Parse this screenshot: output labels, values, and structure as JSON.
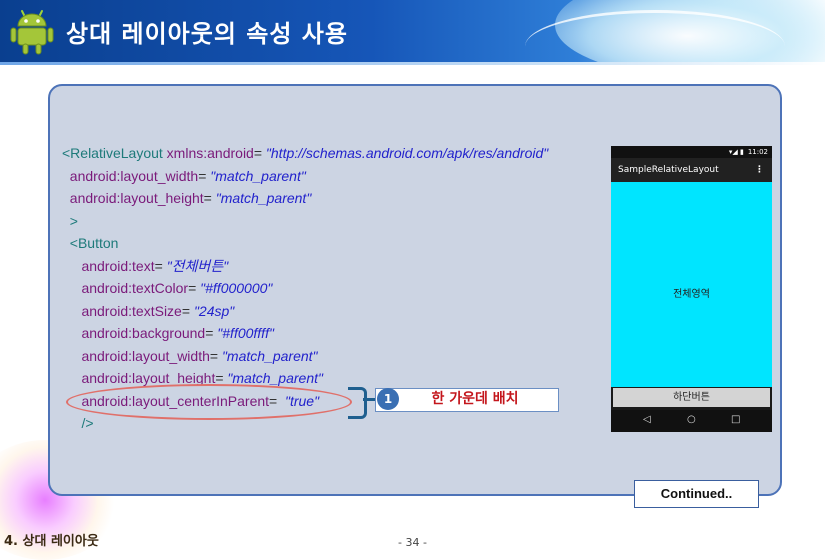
{
  "header": {
    "title": "상대 레이아웃의 속성 사용"
  },
  "code": {
    "lines": [
      {
        "indent": "",
        "tag": "<RelativeLayout",
        "attr": " xmlns:android",
        "eq": "= ",
        "val": "\"http://schemas.android.com/apk/res/android\""
      },
      {
        "indent": "  ",
        "tag": "",
        "attr": "android:layout_width",
        "eq": "= ",
        "val": "\"match_parent\""
      },
      {
        "indent": "  ",
        "tag": "",
        "attr": "android:layout_height",
        "eq": "= ",
        "val": "\"match_parent\""
      },
      {
        "indent": "  ",
        "tag": ">",
        "attr": "",
        "eq": "",
        "val": ""
      },
      {
        "indent": "  ",
        "tag": "<Button",
        "attr": "",
        "eq": "",
        "val": ""
      },
      {
        "indent": "     ",
        "tag": "",
        "attr": "android:text",
        "eq": "= ",
        "val": "\"전체버튼\""
      },
      {
        "indent": "     ",
        "tag": "",
        "attr": "android:textColor",
        "eq": "= ",
        "val": "\"#ff000000\""
      },
      {
        "indent": "     ",
        "tag": "",
        "attr": "android:textSize",
        "eq": "= ",
        "val": "\"24sp\""
      },
      {
        "indent": "     ",
        "tag": "",
        "attr": "android:background",
        "eq": "= ",
        "val": "\"#ff00ffff\""
      },
      {
        "indent": "     ",
        "tag": "",
        "attr": "android:layout_width",
        "eq": "= ",
        "val": "\"match_parent\""
      },
      {
        "indent": "     ",
        "tag": "",
        "attr": "android:layout_height",
        "eq": "= ",
        "val": "\"match_parent\""
      },
      {
        "indent": "     ",
        "tag": "",
        "attr": "android:layout_centerInParent",
        "eq": "=  ",
        "val": "\"true\""
      },
      {
        "indent": "     ",
        "tag": "/>",
        "attr": "",
        "eq": "",
        "val": ""
      }
    ]
  },
  "callout": {
    "number": "1",
    "text": "한 가운데 배치"
  },
  "phone": {
    "status_time": "11:02",
    "app_title": "SampleRelativeLayout",
    "overflow_icon": "⋮",
    "center_label": "전체영역",
    "bottom_button": "하단버튼",
    "nav_back": "◁",
    "nav_home": "○",
    "nav_recent": "□"
  },
  "continued_label": "Continued..",
  "footer": {
    "section": "4. 상대 레이아웃",
    "page": "- 34 -"
  },
  "colors": {
    "accent_blue": "#1656b8",
    "panel_bg": "#ccd4e3",
    "phone_cyan": "#00e5ff",
    "callout_red": "#c4161c"
  }
}
